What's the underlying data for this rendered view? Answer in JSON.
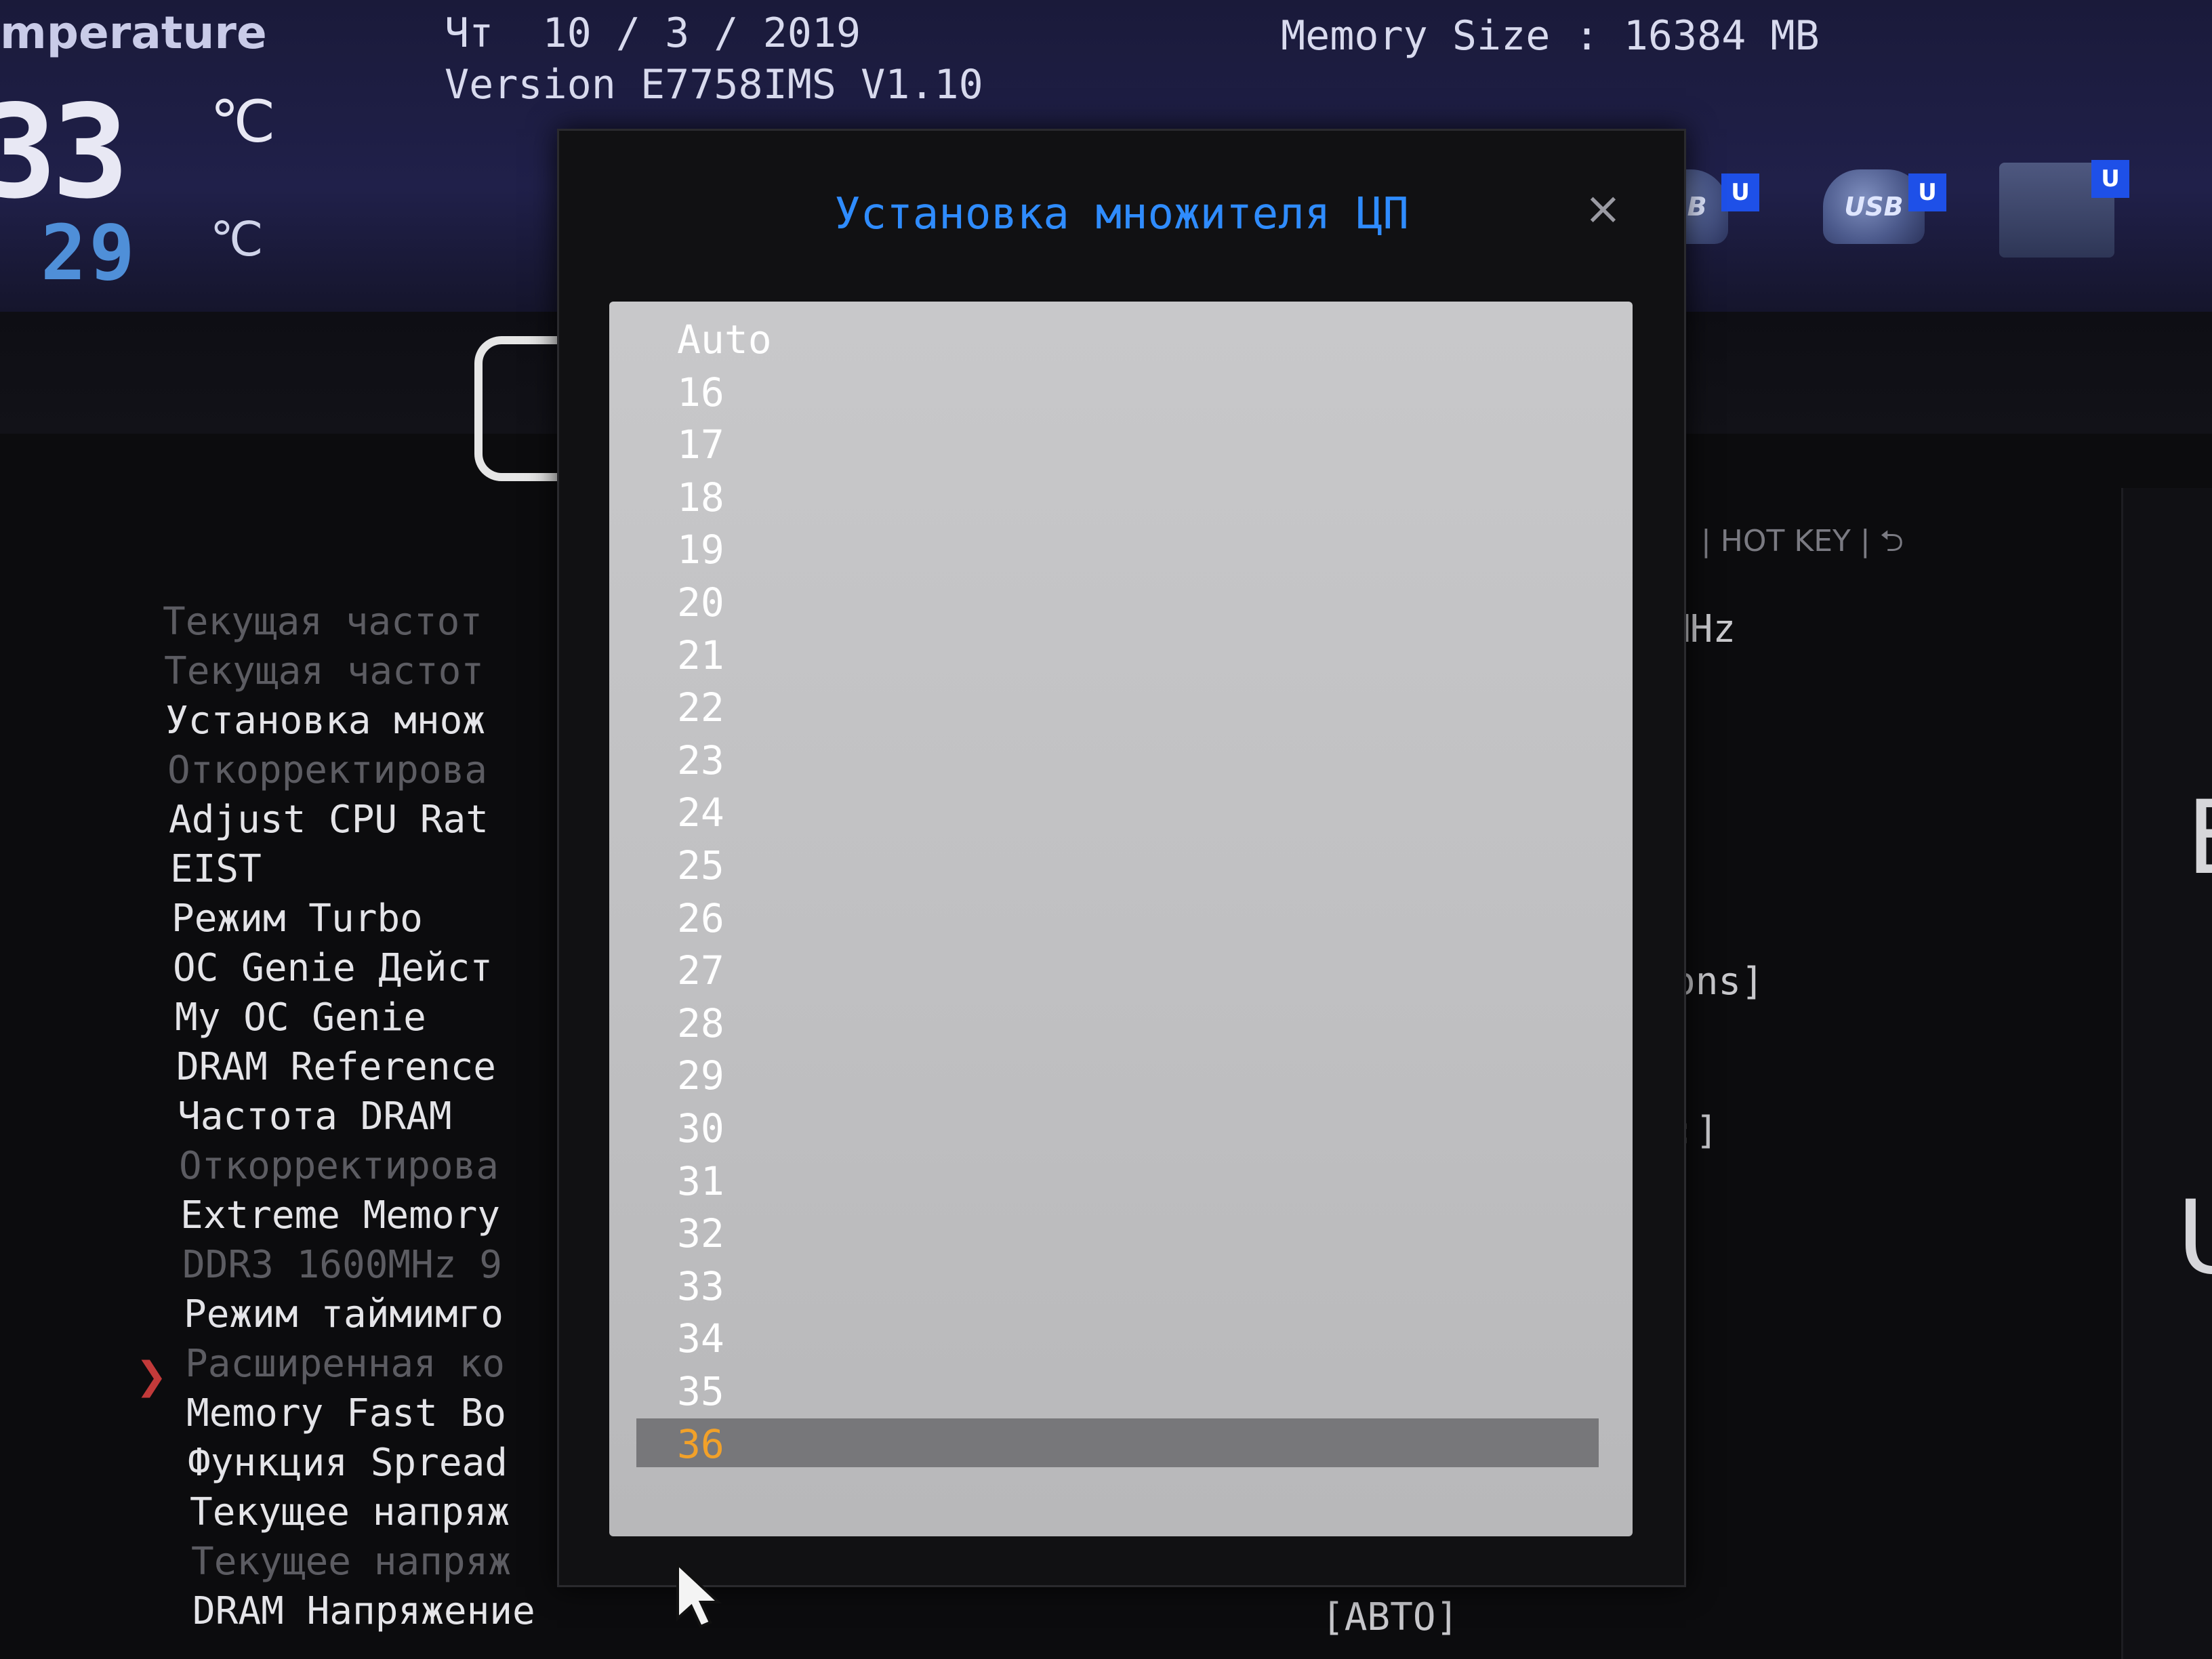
{
  "header": {
    "temperature_label": "mperature",
    "cpu_temp": "33",
    "mb_temp": "29",
    "temp_unit": "℃",
    "date": "Чт  10 / 3 / 2019",
    "version": "Version E7758IMS V1.10",
    "memory": "Memory Size : 16384 MB"
  },
  "boot_icons": [
    {
      "label": "USB",
      "badge": "U"
    },
    {
      "label": "USB",
      "badge": "U"
    },
    {
      "badge": "U"
    }
  ],
  "toolbar": {
    "hotkey": "| HOT KEY | ⮌"
  },
  "menu": {
    "items": [
      {
        "label": "Текущая частот",
        "state": "dim"
      },
      {
        "label": "Текущая частот",
        "state": "dim"
      },
      {
        "label": "Установка множ",
        "state": "bright"
      },
      {
        "label": "Откорректирова",
        "state": "dim"
      },
      {
        "label": "Adjust CPU Rat",
        "state": "bright"
      },
      {
        "label": "EIST",
        "state": "bright"
      },
      {
        "label": "Режим Turbo",
        "state": "bright"
      },
      {
        "label": "OC Genie Дейст",
        "state": "bright"
      },
      {
        "label": "My OC Genie",
        "state": "bright"
      },
      {
        "label": "DRAM Reference",
        "state": "bright"
      },
      {
        "label": "Частота DRAM",
        "state": "bright"
      },
      {
        "label": "Откорректирова",
        "state": "dim"
      },
      {
        "label": "Extreme Memory",
        "state": "bright"
      },
      {
        "label": "DDR3 1600MHz 9",
        "state": "dim"
      },
      {
        "label": "Режим таймимго",
        "state": "bright"
      },
      {
        "label": "Расширенная ко",
        "state": "dim"
      },
      {
        "label": "Memory Fast Bo",
        "state": "bright"
      },
      {
        "label": "Функция Spread",
        "state": "bright"
      },
      {
        "label": "Текущее напряж",
        "state": "bright"
      },
      {
        "label": "Текущее напряж",
        "state": "dim"
      },
      {
        "label": "DRAM Напряжение",
        "state": "bright"
      }
    ],
    "submenu_marker": "❯"
  },
  "right_values": {
    "freq_unit": "MHz",
    "oc_genie_value": "ons]",
    "dram_value": ":]",
    "dram_voltage_value": "[АВТО]"
  },
  "side_chars": [
    "E",
    "U"
  ],
  "dialog": {
    "title": "Установка множителя ЦП",
    "close": "×",
    "options": [
      "Auto",
      "16",
      "17",
      "18",
      "19",
      "20",
      "21",
      "22",
      "23",
      "24",
      "25",
      "26",
      "27",
      "28",
      "29",
      "30",
      "31",
      "32",
      "33",
      "34",
      "35",
      "36"
    ],
    "selected": "36"
  },
  "colors": {
    "title_blue": "#2f8cff",
    "selected_orange": "#f2a129",
    "list_bg": "#c8c8ca",
    "selected_bg": "#77777a"
  }
}
